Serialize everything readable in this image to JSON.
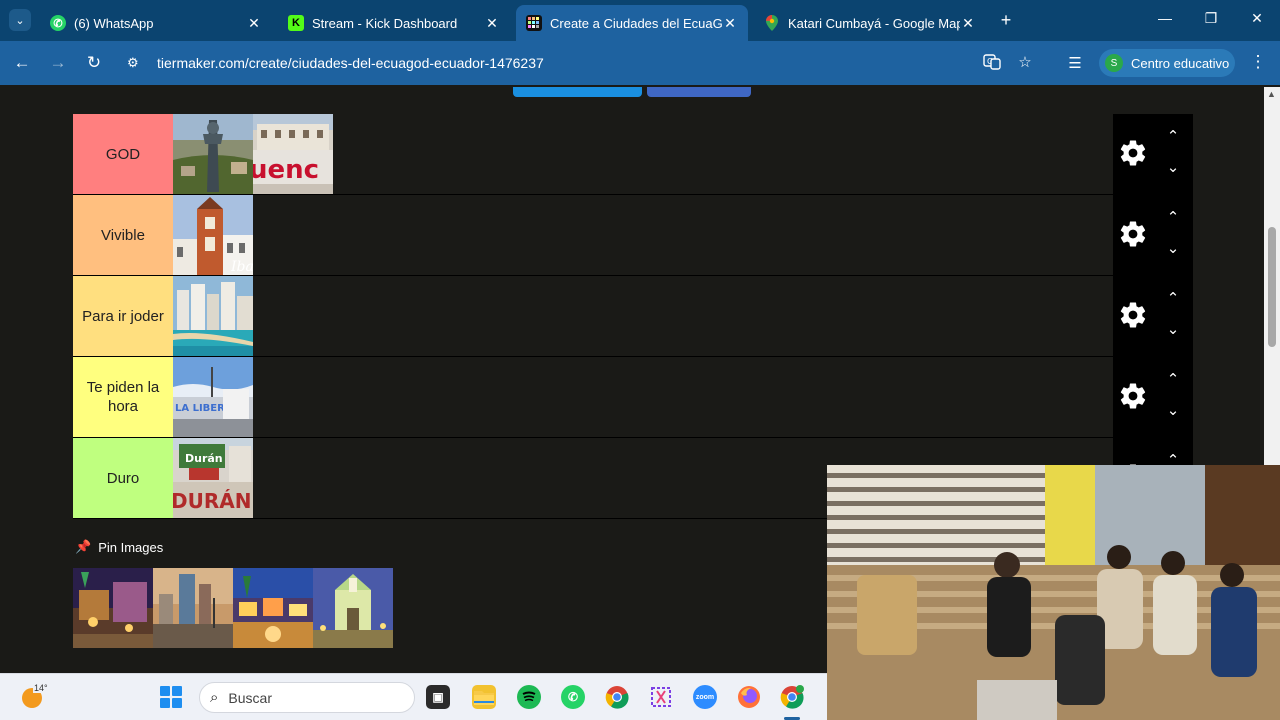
{
  "browser": {
    "tabs": [
      {
        "title": "(6) WhatsApp",
        "icon": "whatsapp-icon",
        "active": false
      },
      {
        "title": "Stream - Kick Dashboard",
        "icon": "kick-icon",
        "active": false
      },
      {
        "title": "Create a Ciudades del EcuaGOD",
        "icon": "tiermaker-icon",
        "active": true
      },
      {
        "title": "Katari Cumbayá - Google Maps",
        "icon": "google-maps-icon",
        "active": false
      }
    ],
    "url": "tiermaker.com/create/ciudades-del-ecuagod-ecuador-1476237",
    "profile_initial": "S",
    "profile_label": "Centro educativo"
  },
  "tiers": [
    {
      "label": "GOD",
      "color": "#ff7f7f",
      "items": 2
    },
    {
      "label": "Vivible",
      "color": "#ffbf7f",
      "items": 1
    },
    {
      "label": "Para ir joder",
      "color": "#ffdf7f",
      "items": 1
    },
    {
      "label": "Te piden la hora",
      "color": "#ffff7f",
      "items": 1
    },
    {
      "label": "Duro",
      "color": "#bfff7f",
      "items": 1
    }
  ],
  "pin": {
    "title": "Pin Images",
    "count": 4
  },
  "taskbar": {
    "temperature": "14°",
    "search_placeholder": "Buscar",
    "apps": [
      "task-view-icon",
      "file-explorer-icon",
      "spotify-icon",
      "whatsapp-icon",
      "chrome-icon",
      "snipping-tool-icon",
      "zoom-icon",
      "firefox-icon",
      "chrome-profile-icon"
    ]
  },
  "colors": {
    "tabbar": "#0b4470",
    "toolbar": "#1e62a0",
    "page_bg": "#1a1a17"
  }
}
